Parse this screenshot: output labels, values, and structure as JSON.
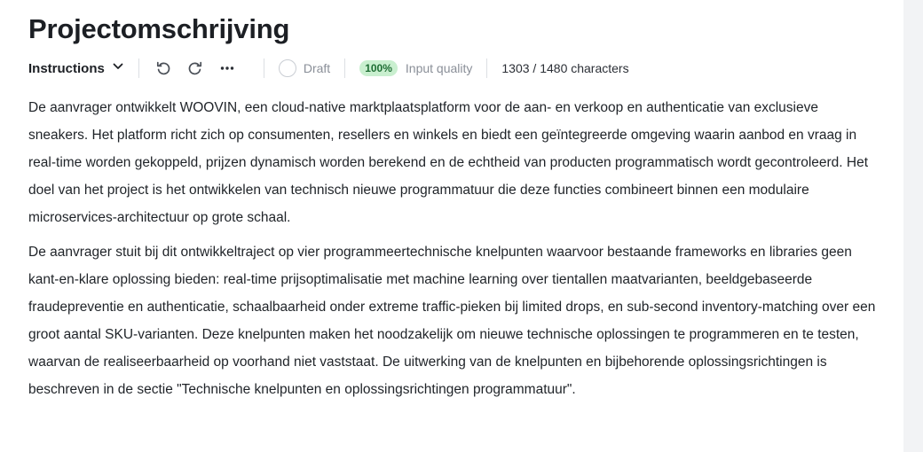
{
  "title": "Projectomschrijving",
  "toolbar": {
    "mode_label": "Instructions",
    "draft_label": "Draft",
    "quality_badge": "100%",
    "quality_label": "Input quality",
    "char_count": "1303 / 1480 characters"
  },
  "icons": {
    "mode": "chevron-down-icon",
    "undo": "undo-icon",
    "redo": "redo-icon",
    "more": "more-horizontal-icon",
    "draft": "radio-circle-icon"
  },
  "colors": {
    "badge_bg": "#c9efcf",
    "badge_text": "#1f6e34"
  },
  "paragraphs": [
    "De aanvrager ontwikkelt WOOVIN, een cloud-native marktplaatsplatform voor de aan- en verkoop en authenticatie van exclusieve sneakers. Het platform richt zich op consumenten, resellers en winkels en biedt een geïntegreerde omgeving waarin aanbod en vraag in real-time worden gekoppeld, prijzen dynamisch worden berekend en de echtheid van producten programmatisch wordt gecontroleerd. Het doel van het project is het ontwikkelen van technisch nieuwe programmatuur die deze functies combineert binnen een modulaire microservices-architectuur op grote schaal.",
    "De aanvrager stuit bij dit ontwikkeltraject op vier programmeertechnische knelpunten waarvoor bestaande frameworks en libraries geen kant-en-klare oplossing bieden: real-time prijsoptimalisatie met machine learning over tientallen maatvarianten, beeldgebaseerde fraudepreventie en authenticatie, schaalbaarheid onder extreme traffic-pieken bij limited drops, en sub-second inventory-matching over een groot aantal SKU-varianten. Deze knelpunten maken het noodzakelijk om nieuwe technische oplossingen te programmeren en te testen, waarvan de realiseerbaarheid op voorhand niet vaststaat. De uitwerking van de knelpunten en bijbehorende oplossingsrichtingen is beschreven in de sectie \"Technische knelpunten en oplossingsrichtingen programmatuur\"."
  ]
}
